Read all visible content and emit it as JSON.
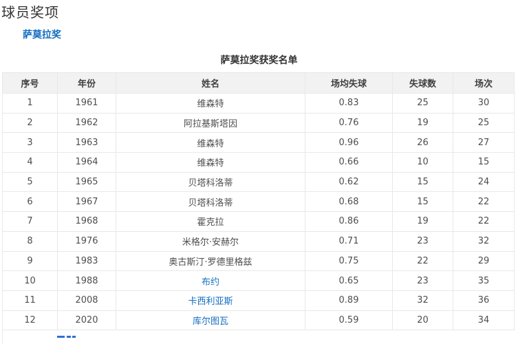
{
  "page": {
    "title": "球员奖项",
    "section_link": "萨莫拉奖",
    "table_caption": "萨莫拉奖获奖名单"
  },
  "colors": {
    "link_blue": "#136ec2",
    "header_bg": "#f2f2f2",
    "border": "#e8e8e8",
    "cell_text": "#4d4d4d",
    "title_text": "#333333"
  },
  "table": {
    "columns": [
      "序号",
      "年份",
      "姓名",
      "场均失球",
      "失球数",
      "场次"
    ],
    "rows": [
      {
        "no": "1",
        "year": "1961",
        "name": "维森特",
        "avg": "0.83",
        "conceded": "25",
        "matches": "30",
        "name_is_link": false
      },
      {
        "no": "2",
        "year": "1962",
        "name": "阿拉基斯塔因",
        "avg": "0.76",
        "conceded": "19",
        "matches": "25",
        "name_is_link": false
      },
      {
        "no": "3",
        "year": "1963",
        "name": "维森特",
        "avg": "0.96",
        "conceded": "26",
        "matches": "27",
        "name_is_link": false
      },
      {
        "no": "4",
        "year": "1964",
        "name": "维森特",
        "avg": "0.66",
        "conceded": "10",
        "matches": "15",
        "name_is_link": false
      },
      {
        "no": "5",
        "year": "1965",
        "name": "贝塔科洛蒂",
        "avg": "0.62",
        "conceded": "15",
        "matches": "24",
        "name_is_link": false
      },
      {
        "no": "6",
        "year": "1967",
        "name": "贝塔科洛蒂",
        "avg": "0.68",
        "conceded": "15",
        "matches": "22",
        "name_is_link": false
      },
      {
        "no": "7",
        "year": "1968",
        "name": "霍克拉",
        "avg": "0.86",
        "conceded": "19",
        "matches": "22",
        "name_is_link": false
      },
      {
        "no": "8",
        "year": "1976",
        "name": "米格尔·安赫尔",
        "avg": "0.71",
        "conceded": "23",
        "matches": "32",
        "name_is_link": false
      },
      {
        "no": "9",
        "year": "1983",
        "name": "奥古斯汀·罗德里格兹",
        "avg": "0.75",
        "conceded": "22",
        "matches": "29",
        "name_is_link": false
      },
      {
        "no": "10",
        "year": "1988",
        "name": "布约",
        "avg": "0.65",
        "conceded": "23",
        "matches": "35",
        "name_is_link": true
      },
      {
        "no": "11",
        "year": "2008",
        "name": "卡西利亚斯",
        "avg": "0.89",
        "conceded": "32",
        "matches": "36",
        "name_is_link": true
      },
      {
        "no": "12",
        "year": "2020",
        "name": "库尔图瓦",
        "avg": "0.59",
        "conceded": "20",
        "matches": "34",
        "name_is_link": true
      }
    ]
  }
}
